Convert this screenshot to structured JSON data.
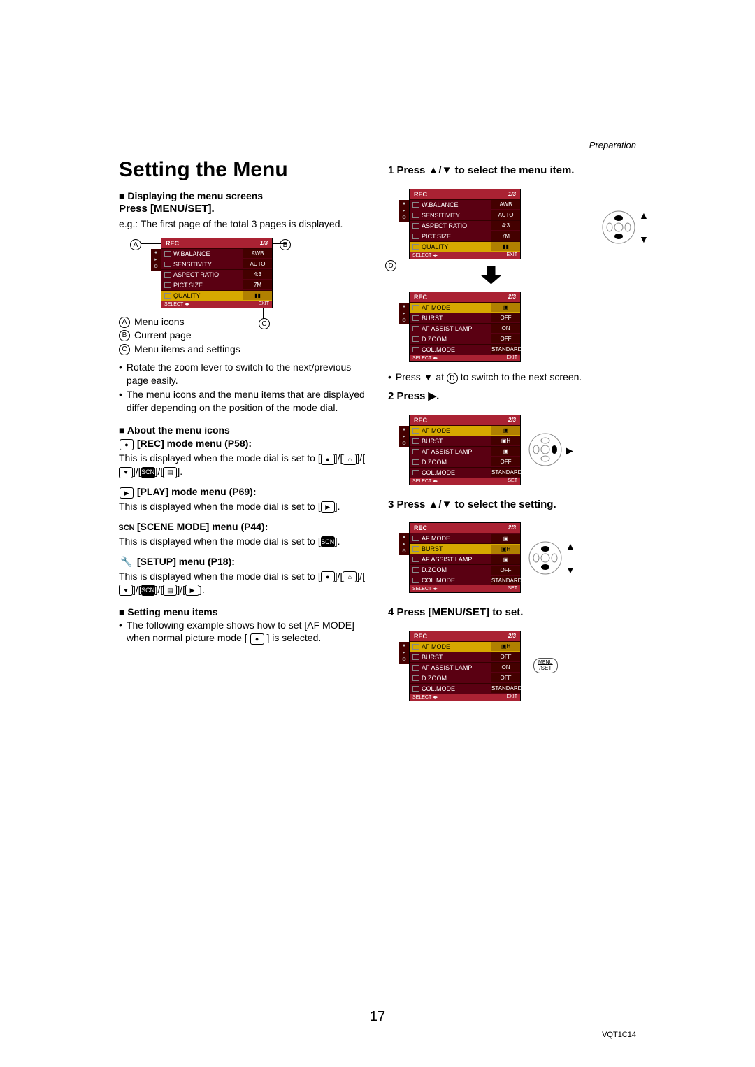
{
  "header": {
    "section": "Preparation"
  },
  "title": "Setting the Menu",
  "left": {
    "s1_title": "Displaying the menu screens",
    "s1_press": "Press [MENU/SET].",
    "s1_eg": "e.g.: The first page of the total 3 pages is displayed.",
    "legend": {
      "a": "Menu icons",
      "b": "Current page",
      "c": "Menu items and settings"
    },
    "tips": [
      "Rotate the zoom lever to switch to the next/previous page easily.",
      "The menu icons and the menu items that are displayed differ depending on the position of the mode dial."
    ],
    "s2_title": "About the menu icons",
    "rec": {
      "label": "[REC] mode menu (P58):",
      "body": "This is displayed when the mode dial is set to [",
      "tail": "]."
    },
    "play": {
      "label": "[PLAY] mode menu (P69):",
      "body": "This is displayed when the mode dial is set to [",
      "tail": "]."
    },
    "scene": {
      "prefix": "SCN",
      "label": "[SCENE MODE] menu (P44):",
      "body": "This is displayed when the mode dial is set to [",
      "tail": "]."
    },
    "setup": {
      "label": "[SETUP] menu (P18):",
      "body": "This is displayed when the mode dial is set to [",
      "tail": "]."
    },
    "s3_title": "Setting menu items",
    "s3_body": "The following example shows how to set [AF MODE] when normal picture mode [",
    "s3_tail": "] is selected."
  },
  "right": {
    "step1": "Press ▲/▼ to select the menu item.",
    "step1_note_a": "Press ▼ at ",
    "step1_note_b": " to switch to the next screen.",
    "step2": "Press ▶.",
    "step3": "Press ▲/▼ to select the setting.",
    "step4": "Press [MENU/SET] to set.",
    "menu_btn_top": "MENU",
    "menu_btn_bot": "/SET"
  },
  "menu1": {
    "title": "REC",
    "page": "1/3",
    "rows": [
      {
        "lbl": "W.BALANCE",
        "val": "AWB"
      },
      {
        "lbl": "SENSITIVITY",
        "val": "AUTO"
      },
      {
        "lbl": "ASPECT RATIO",
        "val": "4:3"
      },
      {
        "lbl": "PICT.SIZE",
        "val": "7M"
      },
      {
        "lbl": "QUALITY",
        "val": "▮▮",
        "hi": true
      }
    ],
    "foot_l": "SELECT ◂▸",
    "foot_r": "EXIT"
  },
  "menu2": {
    "title": "REC",
    "page": "2/3",
    "rows": [
      {
        "lbl": "AF MODE",
        "val": "▣",
        "hi": true
      },
      {
        "lbl": "BURST",
        "val": "OFF"
      },
      {
        "lbl": "AF ASSIST LAMP",
        "val": "ON"
      },
      {
        "lbl": "D.ZOOM",
        "val": "OFF"
      },
      {
        "lbl": "COL.MODE",
        "val": "STANDARD"
      }
    ],
    "foot_l": "SELECT ◂▸",
    "foot_r": "EXIT"
  },
  "menu3": {
    "title": "REC",
    "page": "2/3",
    "rows": [
      {
        "lbl": "AF MODE",
        "val": "▣",
        "hi": true
      },
      {
        "lbl": "BURST",
        "val": "▣H"
      },
      {
        "lbl": "AF ASSIST LAMP",
        "val": "▣"
      },
      {
        "lbl": "D.ZOOM",
        "val": "OFF"
      },
      {
        "lbl": "COL.MODE",
        "val": "STANDARD"
      }
    ],
    "foot_l": "SELECT ◂▸",
    "foot_r": "SET"
  },
  "menu4": {
    "title": "REC",
    "page": "2/3",
    "rows": [
      {
        "lbl": "AF MODE",
        "val": "▣"
      },
      {
        "lbl": "BURST",
        "val": "▣H",
        "hi": true
      },
      {
        "lbl": "AF ASSIST LAMP",
        "val": "▣"
      },
      {
        "lbl": "D.ZOOM",
        "val": "OFF"
      },
      {
        "lbl": "COL.MODE",
        "val": "STANDARD"
      }
    ],
    "foot_l": "SELECT ◂▸",
    "foot_r": "SET"
  },
  "menu5": {
    "title": "REC",
    "page": "2/3",
    "rows": [
      {
        "lbl": "AF MODE",
        "val": "▣H",
        "hi": true
      },
      {
        "lbl": "BURST",
        "val": "OFF"
      },
      {
        "lbl": "AF ASSIST LAMP",
        "val": "ON"
      },
      {
        "lbl": "D.ZOOM",
        "val": "OFF"
      },
      {
        "lbl": "COL.MODE",
        "val": "STANDARD"
      }
    ],
    "foot_l": "SELECT ◂▸",
    "foot_r": "EXIT"
  },
  "footer": {
    "page": "17",
    "code": "VQT1C14"
  }
}
